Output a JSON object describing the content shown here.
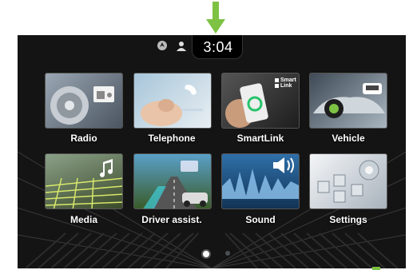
{
  "status": {
    "clock": "3:04",
    "icons": [
      "navigation-status-icon",
      "user-profile-icon"
    ]
  },
  "menu": {
    "items": [
      {
        "label": "Radio",
        "icon": "radio-icon"
      },
      {
        "label": "Telephone",
        "icon": "phone-icon"
      },
      {
        "label": "SmartLink",
        "icon": "smartlink-icon",
        "badge": [
          "Smart",
          "Link"
        ]
      },
      {
        "label": "Vehicle",
        "icon": "car-icon"
      },
      {
        "label": "Media",
        "icon": "music-note-icon"
      },
      {
        "label": "Driver assist.",
        "icon": "driver-assist-icon"
      },
      {
        "label": "Sound",
        "icon": "speaker-icon"
      },
      {
        "label": "Settings",
        "icon": "gear-icon"
      }
    ]
  },
  "pager": {
    "pages": 2,
    "current": 1
  },
  "colors": {
    "accent_green": "#7dc242",
    "background": "#141414",
    "label": "#ffffff"
  }
}
